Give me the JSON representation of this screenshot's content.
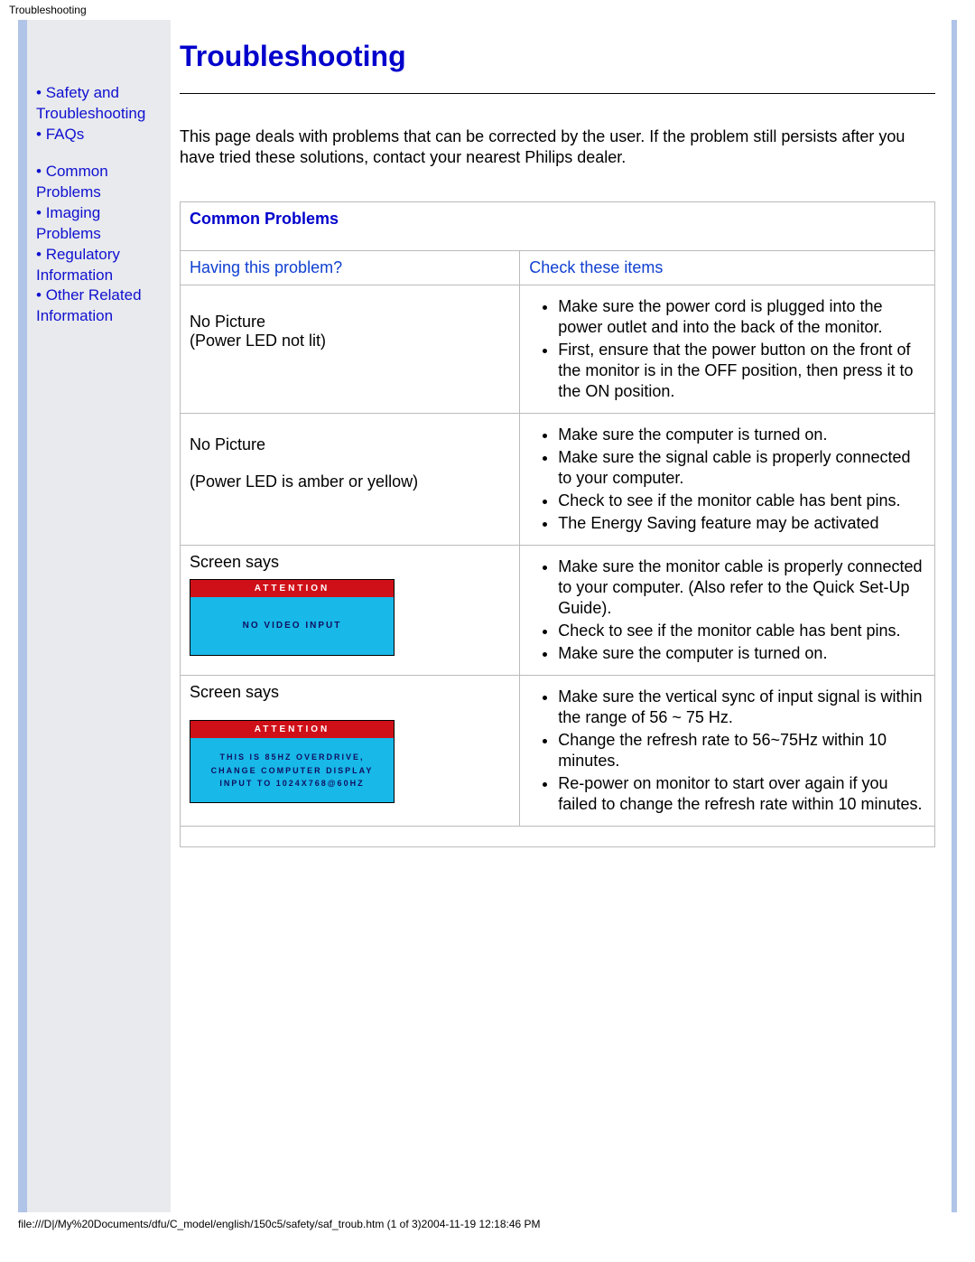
{
  "header": {
    "tiny_title": "Troubleshooting"
  },
  "sidebar": {
    "items": [
      "Safety and Troubleshooting",
      "FAQs",
      "Common Problems",
      "Imaging Problems",
      "Regulatory Information",
      "Other Related Information"
    ]
  },
  "main": {
    "title": "Troubleshooting",
    "intro": "This page deals with problems that can be corrected by the user. If the problem still persists after you have tried these solutions, contact your nearest Philips dealer.",
    "section_title": "Common Problems",
    "col1": "Having this problem?",
    "col2": "Check these items",
    "rows": [
      {
        "problem_line1": "No Picture",
        "problem_line2": "(Power LED not lit)",
        "checks": [
          "Make sure the power cord is plugged into the power outlet and into the back of the monitor.",
          "First, ensure that the power button on the front of the monitor is in the OFF position, then press it to the ON position."
        ]
      },
      {
        "problem_line1": "No Picture",
        "problem_line2": "(Power LED is amber or yellow)",
        "checks": [
          "Make sure the computer is turned on.",
          "Make sure the signal cable is properly connected to your computer.",
          "Check to see if the monitor cable has bent pins.",
          "The Energy Saving feature may be activated"
        ]
      },
      {
        "problem_line1": "Screen says",
        "osd_att": "ATTENTION",
        "osd_msg": "NO VIDEO INPUT",
        "checks": [
          "Make sure the monitor cable is properly connected to your computer. (Also refer to the Quick Set-Up Guide).",
          "Check to see if the monitor cable has bent pins.",
          "Make sure the computer is turned on."
        ]
      },
      {
        "problem_line1": "Screen says",
        "osd_att": "ATTENTION",
        "osd_msg_l1": "THIS IS 85HZ OVERDRIVE,",
        "osd_msg_l2": "CHANGE COMPUTER DISPLAY",
        "osd_msg_l3": "INPUT TO 1024X768@60HZ",
        "checks": [
          "Make sure the vertical sync of input signal is within the range of 56 ~ 75 Hz.",
          "Change the refresh rate to 56~75Hz within 10 minutes.",
          "Re-power on monitor to start over again if you failed to change the refresh rate within 10 minutes."
        ]
      }
    ]
  },
  "footer": {
    "text": "file:///D|/My%20Documents/dfu/C_model/english/150c5/safety/saf_troub.htm (1 of 3)2004-11-19 12:18:46 PM"
  }
}
